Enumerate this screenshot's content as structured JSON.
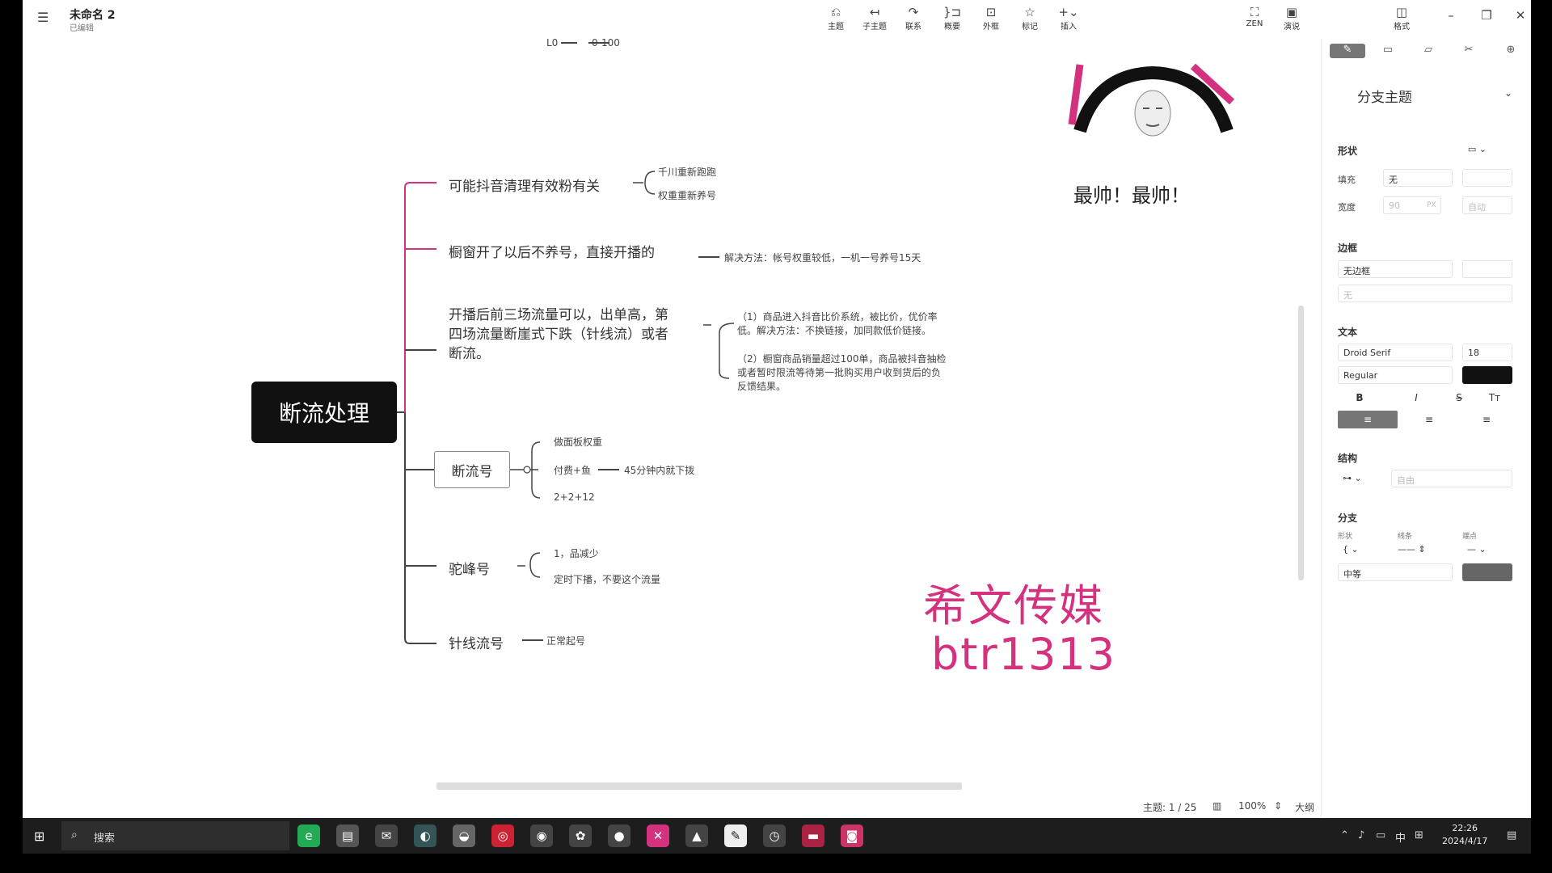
{
  "titlebar": {
    "menu_icon": "hamburger-icon",
    "doc_title": "未命名 2",
    "doc_status": "已编辑",
    "tools": [
      {
        "label": "主题",
        "icon": "topic-icon",
        "glyph": "⎌"
      },
      {
        "label": "子主题",
        "icon": "subtopic-icon",
        "glyph": "↤"
      },
      {
        "label": "联系",
        "icon": "relationship-icon",
        "glyph": "↷"
      },
      {
        "label": "概要",
        "icon": "summary-icon",
        "glyph": "}⊐"
      },
      {
        "label": "外框",
        "icon": "boundary-icon",
        "glyph": "⊡"
      },
      {
        "label": "标记",
        "icon": "marker-icon",
        "glyph": "☆"
      },
      {
        "label": "插入",
        "icon": "insert-icon",
        "glyph": "+⌄"
      }
    ],
    "zen_label": "ZEN",
    "present_label": "演说",
    "format_label": "格式"
  },
  "map": {
    "top_fragment_1": "L0",
    "top_fragment_2": "0-100",
    "root": "断流处理",
    "branches": [
      {
        "label": "可能抖音清理有效粉有关",
        "children": [
          "千川重新跑跑",
          "权重重新养号"
        ]
      },
      {
        "label": "橱窗开了以后不养号，直接开播的",
        "children": [
          "解决方法：帐号权重较低，一机一号养号15天"
        ]
      },
      {
        "label_lines": [
          "开播后前三场流量可以，出单高，第",
          "四场流量断崖式下跌（针线流）或者",
          "断流。"
        ],
        "children_lines": [
          [
            "（1）商品进入抖音比价系统，被比价，优价率",
            "低。解决方法：不换链接，加同款低价链接。"
          ],
          [
            "（2）橱窗商品销量超过100单，商品被抖音抽检",
            "或者暂时限流等待第一批购买用户收到货后的负",
            "反馈结果。"
          ]
        ]
      },
      {
        "label": "断流号",
        "children": [
          "做面板权重",
          "付费+鱼",
          "2+2+12"
        ],
        "grandchild": "45分钟内就下拨"
      },
      {
        "label": "驼峰号",
        "children": [
          "1，品减少",
          "定时下播，不要这个流量"
        ]
      },
      {
        "label": "针线流号",
        "children": [
          "正常起号"
        ]
      }
    ]
  },
  "meme_caption": "最帅！最帅！",
  "watermark": {
    "line1": "希文传媒",
    "line2": "btr1313",
    "color": "#d4317f"
  },
  "status": {
    "topics": "主题: 1 / 25",
    "zoom": "100%",
    "outline": "大纲"
  },
  "panel": {
    "tabs": [
      "style-icon",
      "slide-icon",
      "note-icon",
      "cut-icon",
      "lock-icon"
    ],
    "section_title": "分支主题",
    "shape": {
      "heading": "形状",
      "fill_label": "填充",
      "fill_value": "无",
      "width_label": "宽度",
      "width_value": "90",
      "width_unit": "PX",
      "auto_label": "自动"
    },
    "border": {
      "heading": "边框",
      "value": "无边框",
      "sub_value": "无"
    },
    "text": {
      "heading": "文本",
      "font": "Droid Serif",
      "size": "18",
      "weight": "Regular",
      "color": "#111111",
      "bold": "B",
      "italic": "I",
      "strike": "S",
      "case": "Tт"
    },
    "structure": {
      "heading": "结构",
      "value": "自由"
    },
    "branch": {
      "heading": "分支",
      "shape_label": "形状",
      "line_label": "线条",
      "end_label": "端点",
      "width_value": "中等",
      "color": "#666666"
    }
  },
  "taskbar": {
    "search_placeholder": "搜索",
    "apps": [
      "edge-icon",
      "file-explorer-icon",
      "mail-icon",
      "browser-icon",
      "wechat-icon",
      "recorder-icon",
      "chrome-icon",
      "paint-icon",
      "obs-icon",
      "xmind-icon",
      "photos-icon",
      "notes-icon",
      "clock-app-icon",
      "slides-icon",
      "camera-icon"
    ],
    "ime": "中",
    "time": "22:26",
    "date": "2024/4/17"
  }
}
